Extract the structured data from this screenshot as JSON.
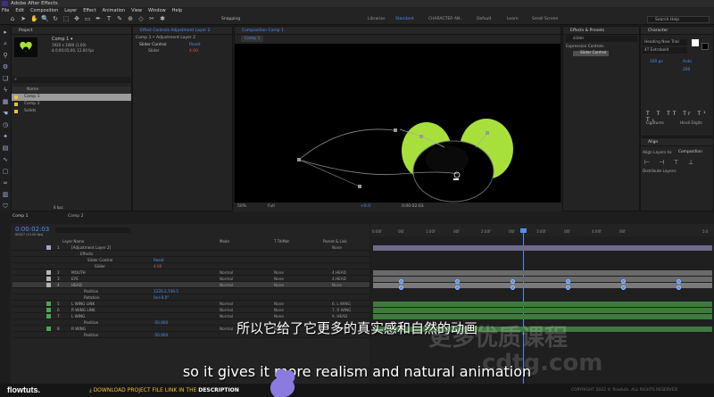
{
  "app": {
    "title": "Adobe After Effects"
  },
  "menu": [
    "File",
    "Edit",
    "Composition",
    "Layer",
    "Effect",
    "Animation",
    "View",
    "Window",
    "Help"
  ],
  "toolbar": {
    "snapping": "Snapping",
    "workspaces": [
      "Default",
      "Learn",
      "Small Screen"
    ],
    "active_workspace": "Standard",
    "other_ws": [
      "Libraries",
      "CHARACTER AN.."
    ],
    "search": "Search Help"
  },
  "project": {
    "tab": "Project",
    "comp_name": "Comp 1 ▾",
    "comp_info1": "1920 x 1080 (1.00)",
    "comp_info2": "Δ 0;00;05;00, 12.00 fps",
    "col_name": "Name",
    "items": [
      "Comp 1",
      "Comp 2",
      "Solids"
    ],
    "bpc": "8 bpc"
  },
  "effects_controls": {
    "tab": "Effect Controls Adjustment Layer 2",
    "sub": "Comp 1 • Adjustment Layer 2",
    "fx": "Slider Control",
    "reset": "Reset",
    "slider": "Slider",
    "slider_val": "4.00"
  },
  "composition": {
    "tab": "Composition Comp 1",
    "breadcrumb": "Comp 1",
    "zoom": "50%",
    "res": "Full",
    "exposure": "+0.0",
    "timecode": "0:00:02:03"
  },
  "effects_presets": {
    "tab": "Effects & Presets",
    "search": "slider",
    "cat": "Expression Controls",
    "item": "Slider Control"
  },
  "character": {
    "tab": "Character",
    "font": "Heading Now Trial",
    "style": "4T Extrabold",
    "size": "100 px",
    "auto": "Auto",
    "px_val": "200",
    "ligatures": "Ligatures",
    "hindi": "Hindi Digits"
  },
  "align": {
    "tab": "Align",
    "align_to": "Align Layers to:",
    "target": "Composition",
    "distribute": "Distribute Layers:"
  },
  "timeline": {
    "tabs": [
      "Comp 1",
      "Comp 2"
    ],
    "time": "0:00:02:03",
    "fps": "00027 (12.00 fps)",
    "headers": {
      "name": "Layer Name",
      "mode": "Mode",
      "track": "T TrkMat",
      "parent": "Parent & Link"
    },
    "ruler": [
      "0:00f",
      "06f",
      "1:00f",
      "06f",
      "2:00f",
      "06f",
      "3:00f",
      "06f",
      "4:00f",
      "06f",
      "5:0"
    ],
    "layers": [
      {
        "num": "1",
        "name": "[Adjustment Layer 2]",
        "mode": "",
        "track": "",
        "parent": "None",
        "color": "#a8a4c9"
      },
      {
        "num": "",
        "name": "Effects",
        "mode": "",
        "track": "",
        "parent": "",
        "color": ""
      },
      {
        "num": "",
        "name": "Slider Control",
        "mode": "Reset",
        "track": "",
        "parent": "",
        "color": ""
      },
      {
        "num": "",
        "name": "Slider",
        "mode": "4.00",
        "track": "",
        "parent": "",
        "color": ""
      },
      {
        "num": "2",
        "name": "MOUTH",
        "mode": "Normal",
        "track": "None",
        "parent": "4.HEAD",
        "color": "#b4b4b4"
      },
      {
        "num": "3",
        "name": "EYE",
        "mode": "Normal",
        "track": "None",
        "parent": "4.HEAD",
        "color": "#b4b4b4"
      },
      {
        "num": "4",
        "name": "HEAD",
        "mode": "Normal",
        "track": "None",
        "parent": "None",
        "color": "#b4b4b4"
      },
      {
        "num": "",
        "name": "Position",
        "mode": "1220.2,749.5",
        "track": "",
        "parent": "",
        "color": ""
      },
      {
        "num": "",
        "name": "Rotation",
        "mode": "0x+0.0°",
        "track": "",
        "parent": "",
        "color": ""
      },
      {
        "num": "5",
        "name": "L WING LINK",
        "mode": "Normal",
        "track": "None",
        "parent": "6. L WING",
        "color": "#4ea54e"
      },
      {
        "num": "6",
        "name": "R WING LINK",
        "mode": "Normal",
        "track": "None",
        "parent": "7. R WING",
        "color": "#4ea54e"
      },
      {
        "num": "7",
        "name": "L WING",
        "mode": "Normal",
        "track": "None",
        "parent": "9. HEAD",
        "color": "#4ea54e"
      },
      {
        "num": "",
        "name": "Position",
        "mode": "-50,904",
        "track": "",
        "parent": "",
        "color": ""
      },
      {
        "num": "8",
        "name": "R WING",
        "mode": "Normal",
        "track": "None",
        "parent": "4. HEAD",
        "color": "#4ea54e"
      },
      {
        "num": "",
        "name": "Position",
        "mode": "-50,904",
        "track": "",
        "parent": "",
        "color": ""
      }
    ]
  },
  "subtitles": {
    "cn": "所以它给了它更多的真实感和自然的动画",
    "en": "so it gives it more realism and natural animation"
  },
  "watermark": {
    "line1": "更多优质课程",
    "line2": "cdtg.com"
  },
  "bottom": {
    "brand": "flowtuts.",
    "download_pre": "DOWNLOAD PROJECT FILE LINK IN THE",
    "download_post": "DESCRIPTION",
    "copyright": "COPYRIGHT 2022 © flowtuts. ALL RIGHTS RESERVED"
  },
  "colors": {
    "accent": "#4f8ef7",
    "lime": "#a8e03b",
    "yellow": "#f2c230"
  }
}
